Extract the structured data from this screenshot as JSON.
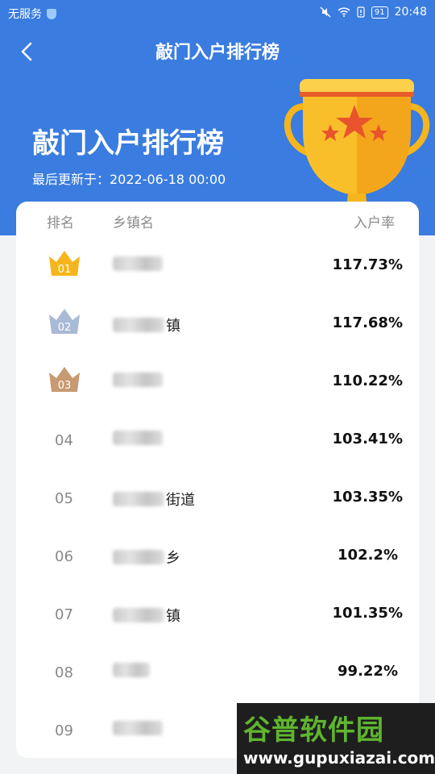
{
  "status_bar": {
    "carrier": "无服务",
    "battery": "91",
    "time": "20:48"
  },
  "header": {
    "title": "敲门入户排行榜",
    "hero_title": "敲门入户排行榜",
    "updated": "最后更新于：2022-06-18 00:00"
  },
  "table": {
    "headers": {
      "rank": "排名",
      "town": "乡镇名",
      "rate": "入户率"
    },
    "rows": [
      {
        "rank": "01",
        "crown": "gold",
        "town_suffix": "",
        "rate": "117.73%"
      },
      {
        "rank": "02",
        "crown": "silver",
        "town_suffix": "镇",
        "rate": "117.68%"
      },
      {
        "rank": "03",
        "crown": "bronze",
        "town_suffix": "",
        "rate": "110.22%"
      },
      {
        "rank": "04",
        "crown": "",
        "town_suffix": "",
        "rate": "103.41%"
      },
      {
        "rank": "05",
        "crown": "",
        "town_suffix": "街道",
        "rate": "103.35%"
      },
      {
        "rank": "06",
        "crown": "",
        "town_suffix": "乡",
        "rate": "102.2%"
      },
      {
        "rank": "07",
        "crown": "",
        "town_suffix": "镇",
        "rate": "101.35%"
      },
      {
        "rank": "08",
        "crown": "",
        "town_suffix": "",
        "rate": "99.22%"
      },
      {
        "rank": "09",
        "crown": "",
        "town_suffix": "",
        "rate": ""
      }
    ]
  },
  "watermark": {
    "name": "谷普软件园",
    "url": "www.gupuxiazai.com"
  },
  "colors": {
    "primary": "#3a7ce0",
    "gold": "#f5b51c",
    "silver": "#a9bad6",
    "bronze": "#c79a72"
  }
}
